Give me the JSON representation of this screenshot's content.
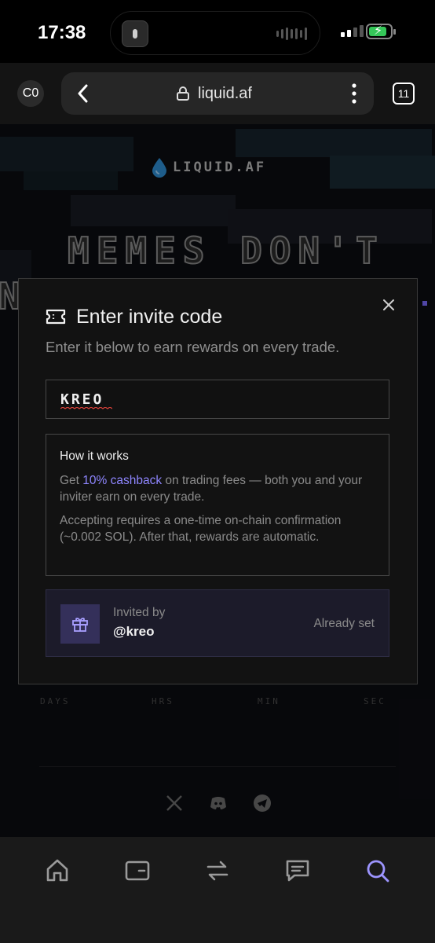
{
  "status_bar": {
    "time": "17:38"
  },
  "browser": {
    "tab_avatar": "C0",
    "url": "liquid.af",
    "tab_count": "11"
  },
  "page": {
    "logo_text": "LIQUID.AF",
    "headline": "MEMES DON'T",
    "headline_line2": "N",
    "countdown_labels": [
      "DAYS",
      "HRS",
      "MIN",
      "SEC"
    ],
    "social_icons": [
      "x-icon",
      "discord-icon",
      "telegram-icon"
    ]
  },
  "modal": {
    "title": "Enter invite code",
    "subtitle": "Enter it below to earn rewards on every trade.",
    "code_value": "KREO",
    "how_it_works": {
      "title": "How it works",
      "p1_prefix": "Get ",
      "p1_accent": "10% cashback",
      "p1_suffix": " on trading fees — both you and your inviter earn on every trade.",
      "p2": "Accepting requires a one-time on-chain confirmation (~0.002 SOL). After that, rewards are automatic."
    },
    "invited": {
      "label": "Invited by",
      "user": "@kreo",
      "status": "Already set"
    }
  },
  "bottom_nav": {
    "items": [
      "home-icon",
      "wallet-icon",
      "swap-icon",
      "chat-icon",
      "search-icon"
    ],
    "active": "search-icon",
    "active_color": "#9d95ff",
    "icon_color": "#9a9a9a"
  },
  "colors": {
    "accent": "#8f86ff",
    "invited_bg": "#1c1b2a"
  }
}
